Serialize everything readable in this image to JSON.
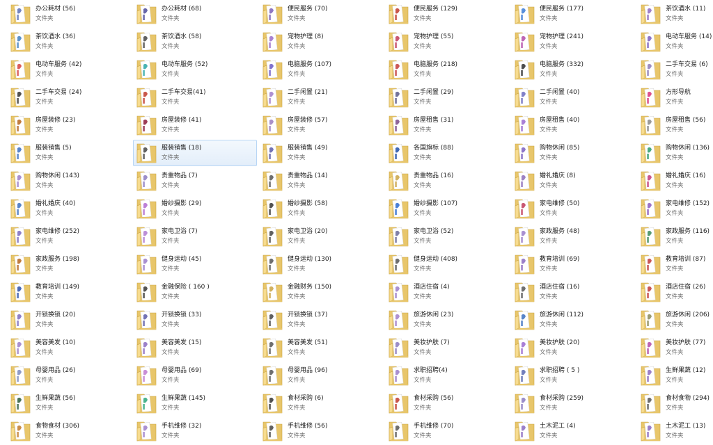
{
  "window": {
    "type_label": "文件夹"
  },
  "colors": {
    "folder_back": "#e8c66b",
    "folder_front": "#f7dc8f",
    "folder_edge": "#c9a344",
    "selection_border": "#b8d6f5",
    "selection_fill": "#e6f0fb"
  },
  "selected_index": 31,
  "items": [
    {
      "name": "办公耗材 (56)",
      "type": "文件夹",
      "accent": "#5a6fb5"
    },
    {
      "name": "办公耗材 (68)",
      "type": "文件夹",
      "accent": "#4a4a9a"
    },
    {
      "name": "便民服务 (70)",
      "type": "文件夹",
      "accent": "#7b5fb8"
    },
    {
      "name": "便民服务 (129)",
      "type": "文件夹",
      "accent": "#c0392b"
    },
    {
      "name": "便民服务 (177)",
      "type": "文件夹",
      "accent": "#3a7bd5"
    },
    {
      "name": "茶饮酒水 (11)",
      "type": "文件夹",
      "accent": "#8e6bbf"
    },
    {
      "name": "茶饮酒水 (36)",
      "type": "文件夹",
      "accent": "#3f7fbf"
    },
    {
      "name": "茶饮酒水 (58)",
      "type": "文件夹",
      "accent": "#444444"
    },
    {
      "name": "宠物护理 (8)",
      "type": "文件夹",
      "accent": "#9a6cc9"
    },
    {
      "name": "宠物护理 (55)",
      "type": "文件夹",
      "accent": "#c03a5a"
    },
    {
      "name": "宠物护理 (241)",
      "type": "文件夹",
      "accent": "#b24aa8"
    },
    {
      "name": "电动车服务 (14)",
      "type": "文件夹",
      "accent": "#7a5fc0"
    },
    {
      "name": "电动车服务 (42)",
      "type": "文件夹",
      "accent": "#d43f3f"
    },
    {
      "name": "电动车服务 (52)",
      "type": "文件夹",
      "accent": "#2aa6a6"
    },
    {
      "name": "电脑服务 (107)",
      "type": "文件夹",
      "accent": "#6b59c6"
    },
    {
      "name": "电脑服务 (218)",
      "type": "文件夹",
      "accent": "#c23b3b"
    },
    {
      "name": "电脑服务 (332)",
      "type": "文件夹",
      "accent": "#2d2d2d"
    },
    {
      "name": "二手车交易 (6)",
      "type": "文件夹",
      "accent": "#8c7ab8"
    },
    {
      "name": "二手车交易 (24)",
      "type": "文件夹",
      "accent": "#333333"
    },
    {
      "name": "二手车交易(41)",
      "type": "文件夹",
      "accent": "#c0392b"
    },
    {
      "name": "二手闲置 (21)",
      "type": "文件夹",
      "accent": "#a07cc9"
    },
    {
      "name": "二手闲置 (29)",
      "type": "文件夹",
      "accent": "#5a5a8a"
    },
    {
      "name": "二手闲置 (40)",
      "type": "文件夹",
      "accent": "#6b6bc0"
    },
    {
      "name": "方形导航",
      "type": "文件夹",
      "accent": "#d6337a"
    },
    {
      "name": "房屋装修 (23)",
      "type": "文件夹",
      "accent": "#b5651d"
    },
    {
      "name": "房屋装修 (41)",
      "type": "文件夹",
      "accent": "#8b1a3a"
    },
    {
      "name": "房屋装修 (57)",
      "type": "文件夹",
      "accent": "#9a7cc0"
    },
    {
      "name": "房屋租售 (31)",
      "type": "文件夹",
      "accent": "#7a4a8a"
    },
    {
      "name": "房屋租售 (40)",
      "type": "文件夹",
      "accent": "#9a6ad0"
    },
    {
      "name": "房屋租售 (56)",
      "type": "文件夹",
      "accent": "#888888"
    },
    {
      "name": "服装销售 (5)",
      "type": "文件夹",
      "accent": "#3a6fc0"
    },
    {
      "name": "服装销售 (18)",
      "type": "文件夹",
      "accent": "#444444"
    },
    {
      "name": "服装销售 (49)",
      "type": "文件夹",
      "accent": "#5a5aa8"
    },
    {
      "name": "各国旗标 (88)",
      "type": "文件夹",
      "accent": "#1f4fa8"
    },
    {
      "name": "购物休闲 (85)",
      "type": "文件夹",
      "accent": "#7a5fc0"
    },
    {
      "name": "购物休闲 (136)",
      "type": "文件夹",
      "accent": "#2a9a6a"
    },
    {
      "name": "购物休闲 (143)",
      "type": "文件夹",
      "accent": "#9a7cc9"
    },
    {
      "name": "贵重物品 (7)",
      "type": "文件夹",
      "accent": "#8a7ac0"
    },
    {
      "name": "贵重物品 (14)",
      "type": "文件夹",
      "accent": "#555555"
    },
    {
      "name": "贵重物品 (16)",
      "type": "文件夹",
      "accent": "#c9a344"
    },
    {
      "name": "婚礼婚庆 (8)",
      "type": "文件夹",
      "accent": "#8c6cb8"
    },
    {
      "name": "婚礼婚庆 (16)",
      "type": "文件夹",
      "accent": "#c23b7a"
    },
    {
      "name": "婚礼婚庆 (40)",
      "type": "文件夹",
      "accent": "#3a6fc0"
    },
    {
      "name": "婚纱摄影 (29)",
      "type": "文件夹",
      "accent": "#b06ad0"
    },
    {
      "name": "婚纱摄影 (58)",
      "type": "文件夹",
      "accent": "#333333"
    },
    {
      "name": "婚纱摄影 (107)",
      "type": "文件夹",
      "accent": "#2a6ad0"
    },
    {
      "name": "家电维修 (50)",
      "type": "文件夹",
      "accent": "#c03a5a"
    },
    {
      "name": "家电维修 (152)",
      "type": "文件夹",
      "accent": "#8a5ac0"
    },
    {
      "name": "家电维修 (252)",
      "type": "文件夹",
      "accent": "#7a6ac0"
    },
    {
      "name": "家电卫浴 (7)",
      "type": "文件夹",
      "accent": "#b07ad0"
    },
    {
      "name": "家电卫浴 (20)",
      "type": "文件夹",
      "accent": "#444444"
    },
    {
      "name": "家电卫浴 (52)",
      "type": "文件夹",
      "accent": "#6a6a9a"
    },
    {
      "name": "家政服务 (48)",
      "type": "文件夹",
      "accent": "#9a7cc9"
    },
    {
      "name": "家政服务 (116)",
      "type": "文件夹",
      "accent": "#3a8a5a"
    },
    {
      "name": "家政服务 (198)",
      "type": "文件夹",
      "accent": "#b5651d"
    },
    {
      "name": "健身运动 (45)",
      "type": "文件夹",
      "accent": "#9a7cc9"
    },
    {
      "name": "健身运动 (130)",
      "type": "文件夹",
      "accent": "#555555"
    },
    {
      "name": "健身运动 (408)",
      "type": "文件夹",
      "accent": "#555555"
    },
    {
      "name": "教育培训 (69)",
      "type": "文件夹",
      "accent": "#8a6ac0"
    },
    {
      "name": "教育培训 (87)",
      "type": "文件夹",
      "accent": "#c03a3a"
    },
    {
      "name": "教育培训 (149)",
      "type": "文件夹",
      "accent": "#2a4fa8"
    },
    {
      "name": "金融保险 ( 160 )",
      "type": "文件夹",
      "accent": "#333333"
    },
    {
      "name": "金融财务 (150)",
      "type": "文件夹",
      "accent": "#c9a344"
    },
    {
      "name": "酒店住宿 (4)",
      "type": "文件夹",
      "accent": "#9a7cc9"
    },
    {
      "name": "酒店住宿 (16)",
      "type": "文件夹",
      "accent": "#555555"
    },
    {
      "name": "酒店住宿 (26)",
      "type": "文件夹",
      "accent": "#c03a3a"
    },
    {
      "name": "开锁换锁 (20)",
      "type": "文件夹",
      "accent": "#7a6ac0"
    },
    {
      "name": "开锁换锁 (33)",
      "type": "文件夹",
      "accent": "#5a5aa8"
    },
    {
      "name": "开锁换锁 (37)",
      "type": "文件夹",
      "accent": "#444444"
    },
    {
      "name": "旅游休闲 (23)",
      "type": "文件夹",
      "accent": "#a07cc9"
    },
    {
      "name": "旅游休闲 (112)",
      "type": "文件夹",
      "accent": "#3a6fc0"
    },
    {
      "name": "旅游休闲 (206)",
      "type": "文件夹",
      "accent": "#8a8a5a"
    },
    {
      "name": "美容美发 (10)",
      "type": "文件夹",
      "accent": "#9a7cc9"
    },
    {
      "name": "美容美发 (15)",
      "type": "文件夹",
      "accent": "#8a6ac0"
    },
    {
      "name": "美容美发 (51)",
      "type": "文件夹",
      "accent": "#555555"
    },
    {
      "name": "美妆护肤 (7)",
      "type": "文件夹",
      "accent": "#8a7ac0"
    },
    {
      "name": "美妆护肤 (20)",
      "type": "文件夹",
      "accent": "#9a6ad0"
    },
    {
      "name": "美妆护肤 (77)",
      "type": "文件夹",
      "accent": "#b04aa8"
    },
    {
      "name": "母婴用品 (26)",
      "type": "文件夹",
      "accent": "#7a8ac0"
    },
    {
      "name": "母婴用品 (69)",
      "type": "文件夹",
      "accent": "#c07ad0"
    },
    {
      "name": "母婴用品 (96)",
      "type": "文件夹",
      "accent": "#555555"
    },
    {
      "name": "求职招聘(4)",
      "type": "文件夹",
      "accent": "#9a7cc9"
    },
    {
      "name": "求职招聘 ( 5 )",
      "type": "文件夹",
      "accent": "#5a6ab0"
    },
    {
      "name": "生鲜果蔬 (12)",
      "type": "文件夹",
      "accent": "#8a6ac0"
    },
    {
      "name": "生鲜果蔬 (56)",
      "type": "文件夹",
      "accent": "#2a5a3a"
    },
    {
      "name": "生鲜果蔬 (145)",
      "type": "文件夹",
      "accent": "#2aa67a"
    },
    {
      "name": "食材采购 (6)",
      "type": "文件夹",
      "accent": "#333333"
    },
    {
      "name": "食材采购 (56)",
      "type": "文件夹",
      "accent": "#c0392b"
    },
    {
      "name": "食材采购 (259)",
      "type": "文件夹",
      "accent": "#8a7ac0"
    },
    {
      "name": "食材食物 (294)",
      "type": "文件夹",
      "accent": "#555555"
    },
    {
      "name": "食物食材 (306)",
      "type": "文件夹",
      "accent": "#c07a2a"
    },
    {
      "name": "手机维修 (32)",
      "type": "文件夹",
      "accent": "#9a7cc9"
    },
    {
      "name": "手机维修 (56)",
      "type": "文件夹",
      "accent": "#444444"
    },
    {
      "name": "手机维修 (70)",
      "type": "文件夹",
      "accent": "#555555"
    },
    {
      "name": "土木泥工 (4)",
      "type": "文件夹",
      "accent": "#8a6ac0"
    },
    {
      "name": "土木泥工 (13)",
      "type": "文件夹",
      "accent": "#8a6ac0"
    }
  ]
}
